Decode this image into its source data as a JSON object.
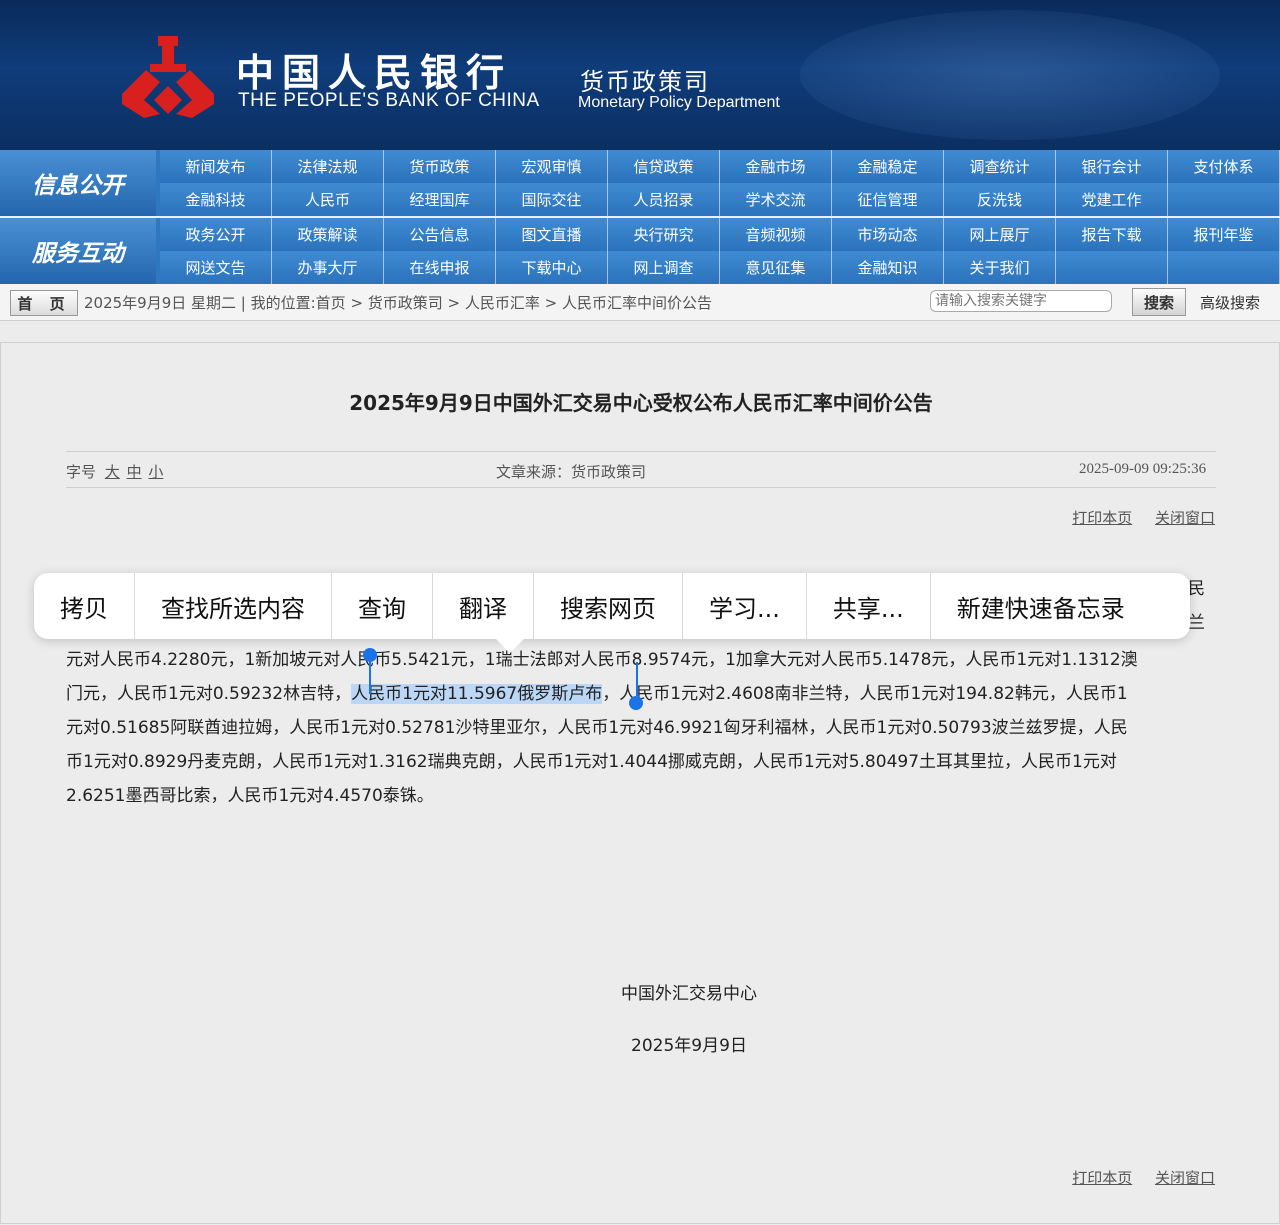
{
  "header": {
    "org_cn": "中国人民银行",
    "org_en": "THE PEOPLE'S BANK OF CHINA",
    "dept_cn": "货币政策司",
    "dept_en": "Monetary Policy Department",
    "logo_color": "#d8201f"
  },
  "nav": {
    "section1": "信息公开",
    "section2": "服务互动",
    "row1": [
      "新闻发布",
      "法律法规",
      "货币政策",
      "宏观审慎",
      "信贷政策",
      "金融市场",
      "金融稳定",
      "调查统计",
      "银行会计",
      "支付体系"
    ],
    "row2": [
      "金融科技",
      "人民币",
      "经理国库",
      "国际交往",
      "人员招录",
      "学术交流",
      "征信管理",
      "反洗钱",
      "党建工作",
      ""
    ],
    "row3": [
      "政务公开",
      "政策解读",
      "公告信息",
      "图文直播",
      "央行研究",
      "音频视频",
      "市场动态",
      "网上展厅",
      "报告下载",
      "报刊年鉴"
    ],
    "row4": [
      "网送文告",
      "办事大厅",
      "在线申报",
      "下载中心",
      "网上调查",
      "意见征集",
      "金融知识",
      "关于我们",
      "",
      ""
    ]
  },
  "breadcrumb": {
    "home": "首 页",
    "text": "2025年9月9日 星期二 | 我的位置:首页 > 货币政策司 > 人民币汇率 > 人民币汇率中间价公告",
    "search_placeholder": "请输入搜索关键字",
    "search_button": "搜索",
    "advanced": "高级搜索"
  },
  "article": {
    "title": "2025年9月9日中国外汇交易中心受权公布人民币汇率中间价公告",
    "font_label": "字号",
    "size_large": "大",
    "size_medium": "中",
    "size_small": "小",
    "source": "文章来源：货币政策司",
    "datetime": "2025-09-09 09:25:36",
    "print": "打印本页",
    "close": "关闭窗口",
    "peek_right1": "民",
    "peek_right2": "兰",
    "line1a": "元对人民币4.2280元，1新加坡元对人民币5.5421元，1瑞士法郎对人民币8.9574元，1加拿大元对人民币5.1478元，人民币1元对1.1312澳",
    "line2a": "门元，人民币1元对0.59232林吉特，",
    "line2_selected": "人民币1元对11.5967俄罗斯卢布",
    "line2b": "，人民币1元对2.4608南非兰特，人民币1元对194.82韩元，人民币1",
    "line3": "元对0.51685阿联酋迪拉姆，人民币1元对0.52781沙特里亚尔，人民币1元对46.9921匈牙利福林，人民币1元对0.50793波兰兹罗提，人民",
    "line4": "币1元对0.8929丹麦克朗，人民币1元对1.3162瑞典克朗，人民币1元对1.4044挪威克朗，人民币1元对5.80497土耳其里拉，人民币1元对",
    "line5": "2.6251墨西哥比索，人民币1元对4.4570泰铢。",
    "signature": "中国外汇交易中心",
    "sign_date": "2025年9月9日"
  },
  "context_menu": {
    "items": [
      "拷贝",
      "查找所选内容",
      "查询",
      "翻译",
      "搜索网页",
      "学习...",
      "共享...",
      "新建快速备忘录"
    ]
  }
}
